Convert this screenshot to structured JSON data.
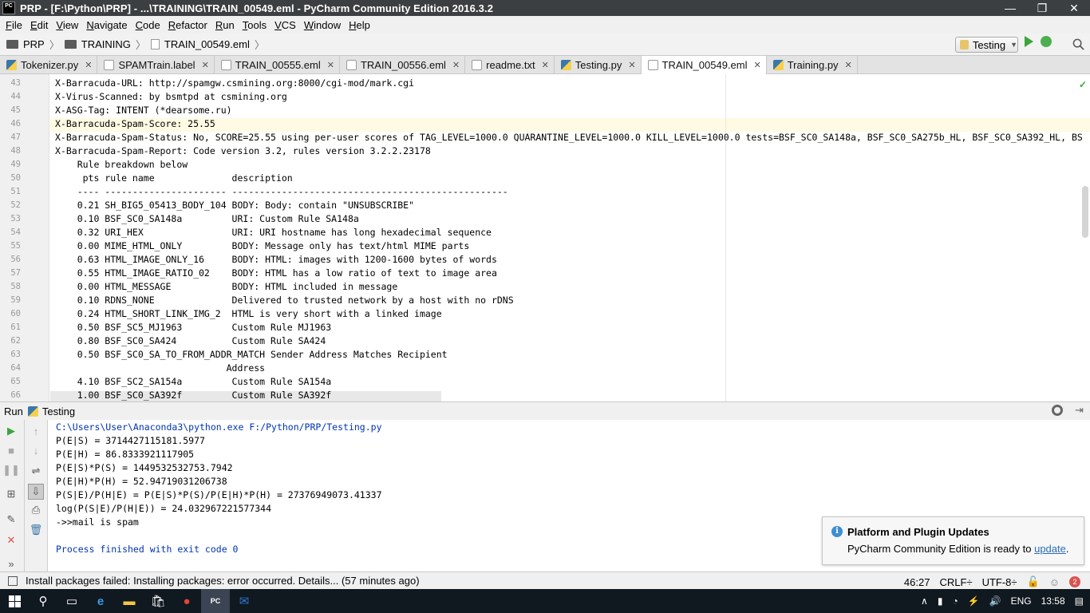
{
  "window": {
    "logo": "PC",
    "title": "PRP - [F:\\Python\\PRP] - ...\\TRAINING\\TRAIN_00549.eml - PyCharm Community Edition 2016.3.2",
    "minimize": "—",
    "maximize": "❐",
    "close": "✕"
  },
  "menu": [
    {
      "u": "F",
      "rest": "ile"
    },
    {
      "u": "E",
      "rest": "dit"
    },
    {
      "u": "V",
      "rest": "iew"
    },
    {
      "u": "N",
      "rest": "avigate"
    },
    {
      "u": "C",
      "rest": "ode"
    },
    {
      "u": "R",
      "rest": "efactor"
    },
    {
      "u": "R",
      "rest": "un"
    },
    {
      "u": "T",
      "rest": "ools"
    },
    {
      "u": "V",
      "rest": "CS"
    },
    {
      "u": "W",
      "rest": "indow"
    },
    {
      "u": "H",
      "rest": "elp"
    }
  ],
  "breadcrumb": {
    "project": "PRP",
    "folder": "TRAINING",
    "file": "TRAIN_00549.eml"
  },
  "run_config": {
    "label": "Testing"
  },
  "tabs": [
    {
      "label": "Tokenizer.py",
      "icon": "py"
    },
    {
      "label": "SPAMTrain.label",
      "icon": "txt"
    },
    {
      "label": "TRAIN_00555.eml",
      "icon": "txt"
    },
    {
      "label": "TRAIN_00556.eml",
      "icon": "txt"
    },
    {
      "label": "readme.txt",
      "icon": "txt"
    },
    {
      "label": "Testing.py",
      "icon": "py"
    },
    {
      "label": "TRAIN_00549.eml",
      "icon": "txt",
      "active": true
    },
    {
      "label": "Training.py",
      "icon": "py"
    }
  ],
  "editor": {
    "lines": [
      {
        "n": "43",
        "text": "X-Barracuda-URL: http://spamgw.csmining.org:8000/cgi-mod/mark.cgi"
      },
      {
        "n": "44",
        "text": "X-Virus-Scanned: by bsmtpd at csmining.org"
      },
      {
        "n": "45",
        "text": "X-ASG-Tag: INTENT (*dearsome.ru)"
      },
      {
        "n": "46",
        "text": "X-Barracuda-Spam-Score: 25.55"
      },
      {
        "n": "47",
        "text": "X-Barracuda-Spam-Status: No, SCORE=25.55 using per-user scores of TAG_LEVEL=1000.0 QUARANTINE_LEVEL=1000.0 KILL_LEVEL=1000.0 tests=BSF_SC0_SA148a, BSF_SC0_SA275b_HL, BSF_SC0_SA392_HL, BS"
      },
      {
        "n": "48",
        "text": "X-Barracuda-Spam-Report: Code version 3.2, rules version 3.2.2.23178"
      },
      {
        "n": "49",
        "text": "    Rule breakdown below"
      },
      {
        "n": "50",
        "text": "     pts rule name              description"
      },
      {
        "n": "51",
        "text": "    ---- ---------------------- --------------------------------------------------"
      },
      {
        "n": "52",
        "text": "    0.21 SH_BIG5_05413_BODY_104 BODY: Body: contain \"UNSUBSCRIBE\""
      },
      {
        "n": "53",
        "text": "    0.10 BSF_SC0_SA148a         URI: Custom Rule SA148a"
      },
      {
        "n": "54",
        "text": "    0.32 URI_HEX                URI: URI hostname has long hexadecimal sequence"
      },
      {
        "n": "55",
        "text": "    0.00 MIME_HTML_ONLY         BODY: Message only has text/html MIME parts"
      },
      {
        "n": "56",
        "text": "    0.63 HTML_IMAGE_ONLY_16     BODY: HTML: images with 1200-1600 bytes of words"
      },
      {
        "n": "57",
        "text": "    0.55 HTML_IMAGE_RATIO_02    BODY: HTML has a low ratio of text to image area"
      },
      {
        "n": "58",
        "text": "    0.00 HTML_MESSAGE           BODY: HTML included in message"
      },
      {
        "n": "59",
        "text": "    0.10 RDNS_NONE              Delivered to trusted network by a host with no rDNS"
      },
      {
        "n": "60",
        "text": "    0.24 HTML_SHORT_LINK_IMG_2  HTML is very short with a linked image"
      },
      {
        "n": "61",
        "text": "    0.50 BSF_SC5_MJ1963         Custom Rule MJ1963"
      },
      {
        "n": "62",
        "text": "    0.80 BSF_SC0_SA424          Custom Rule SA424"
      },
      {
        "n": "63",
        "text": "    0.50 BSF_SC0_SA_TO_FROM_ADDR_MATCH Sender Address Matches Recipient"
      },
      {
        "n": "64",
        "text": "                               Address"
      },
      {
        "n": "65",
        "text": "    4.10 BSF_SC2_SA154a         Custom Rule SA154a"
      },
      {
        "n": "66",
        "text": "    1.00 BSF_SC0_SA392f         Custom Rule SA392f"
      }
    ]
  },
  "run_panel": {
    "label": "Run",
    "config": "Testing",
    "output": [
      {
        "text": "C:\\Users\\User\\Anaconda3\\python.exe F:/Python/PRP/Testing.py",
        "blue": true
      },
      {
        "text": "P(E|S) = 3714427115181.5977"
      },
      {
        "text": "P(E|H) = 86.8333921117905"
      },
      {
        "text": "P(E|S)*P(S) = 1449532532753.7942"
      },
      {
        "text": "P(E|H)*P(H) = 52.94719031206738"
      },
      {
        "text": "P(S|E)/P(H|E) = P(E|S)*P(S)/P(E|H)*P(H) = 27376949073.41337"
      },
      {
        "text": "log(P(S|E)/P(H|E)) = 24.032967221577344"
      },
      {
        "text": "->>mail is spam"
      },
      {
        "text": ""
      },
      {
        "text": "Process finished with exit code 0",
        "blue": true
      }
    ]
  },
  "notification": {
    "title": "Platform and Plugin Updates",
    "body": "PyCharm Community Edition is ready to ",
    "link": "update",
    "after": "."
  },
  "status": {
    "message": "Install packages failed: Installing packages: error occurred. Details... (57 minutes ago)",
    "position": "46:27",
    "line_sep": "CRLF÷",
    "encoding": "UTF-8÷",
    "errors": "2"
  },
  "taskbar": {
    "lang": "ENG",
    "time": "13:58"
  }
}
